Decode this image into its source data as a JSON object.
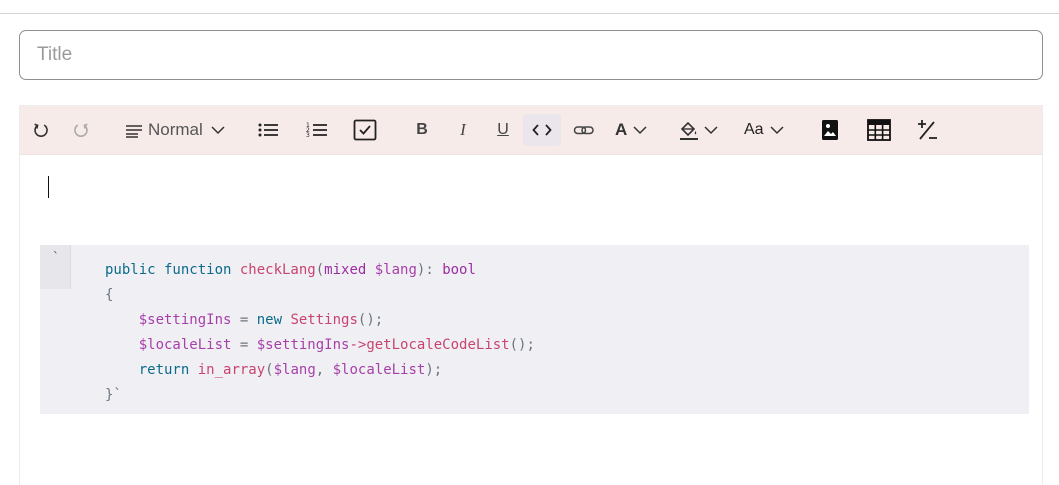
{
  "title_field": {
    "placeholder": "Title",
    "value": ""
  },
  "toolbar": {
    "undo_icon": "undo-icon",
    "redo_icon": "redo-icon",
    "block_format": {
      "label": "Normal",
      "icon": "paragraph-lines-icon"
    },
    "bullet_list_icon": "bullet-list-icon",
    "numbered_list_icon": "numbered-list-icon",
    "check_list_icon": "checkbox-list-icon",
    "bold_label": "B",
    "italic_label": "I",
    "underline_label": "U",
    "code_icon": "code-icon",
    "link_icon": "link-icon",
    "font_color_label": "A",
    "bg_color_icon": "paint-bucket-icon",
    "font_size_label": "Aa",
    "image_icon": "image-icon",
    "table_icon": "table-icon",
    "clear_format_icon": "clear-formatting-icon",
    "active_color": "#ebe6ec",
    "background_color": "#f7ebea"
  },
  "code_block": {
    "gutter_mark": "`",
    "lines": [
      [
        {
          "t": "public function ",
          "c": "kw"
        },
        {
          "t": "checkLang",
          "c": "fn"
        },
        {
          "t": "(",
          "c": "punct"
        },
        {
          "t": "mixed ",
          "c": "type"
        },
        {
          "t": "$lang",
          "c": "var"
        },
        {
          "t": "): ",
          "c": "punct"
        },
        {
          "t": "bool",
          "c": "type"
        }
      ],
      [
        {
          "t": "{",
          "c": "punct"
        }
      ],
      [
        {
          "t": "    ",
          "c": "plain"
        },
        {
          "t": "$settingIns",
          "c": "var"
        },
        {
          "t": " = ",
          "c": "punct"
        },
        {
          "t": "new ",
          "c": "kw"
        },
        {
          "t": "Settings",
          "c": "fn"
        },
        {
          "t": "();",
          "c": "punct"
        }
      ],
      [
        {
          "t": "    ",
          "c": "plain"
        },
        {
          "t": "$localeList",
          "c": "var"
        },
        {
          "t": " = ",
          "c": "punct"
        },
        {
          "t": "$settingIns",
          "c": "var"
        },
        {
          "t": "->",
          "c": "fn"
        },
        {
          "t": "getLocaleCodeList",
          "c": "fn"
        },
        {
          "t": "();",
          "c": "punct"
        }
      ],
      [
        {
          "t": "    ",
          "c": "plain"
        },
        {
          "t": "return ",
          "c": "kw"
        },
        {
          "t": "in_array",
          "c": "fn"
        },
        {
          "t": "(",
          "c": "punct"
        },
        {
          "t": "$lang",
          "c": "var"
        },
        {
          "t": ", ",
          "c": "punct"
        },
        {
          "t": "$localeList",
          "c": "var"
        },
        {
          "t": ");",
          "c": "punct"
        }
      ],
      [
        {
          "t": "}`",
          "c": "punct"
        }
      ]
    ]
  }
}
